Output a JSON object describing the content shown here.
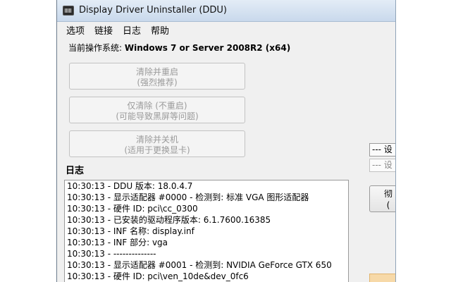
{
  "window": {
    "title": "Display Driver Uninstaller (DDU)",
    "menu": [
      "选项",
      "链接",
      "日志",
      "帮助"
    ],
    "os_label": "当前操作系统:",
    "os_value": "Windows 7 or Server 2008R2 (x64)"
  },
  "actions": [
    {
      "line1": "清除并重启",
      "line2": "(强烈推荐)"
    },
    {
      "line1": "仅清除 (不重启)",
      "line2": "(可能导致黑屏等问题)"
    },
    {
      "line1": "清除并关机",
      "line2": "(适用于更换显卡)"
    }
  ],
  "log": {
    "title": "日志",
    "lines": [
      "10:30:13 - DDU 版本: 18.0.4.7",
      "10:30:13 - 显示适配器 #0000 - 检测到: 标准 VGA 图形适配器",
      "10:30:13 - 硬件 ID: pci\\cc_0300",
      "10:30:13 - 已安装的驱动程序版本: 6.1.7600.16385",
      "10:30:13 - INF 名称: display.inf",
      "10:30:13 - INF 部分: vga",
      "10:30:13 - --------------",
      "10:30:13 - 显示适配器 #0001 - 检测到: NVIDIA GeForce GTX 650",
      "10:30:13 - 硬件 ID: pci\\ven_10de&dev_0fc6"
    ]
  },
  "side": {
    "combo1": "--- 设",
    "combo2": "--- 设",
    "button_line1": "彻",
    "button_line2": "("
  },
  "colors": {
    "title_gradient_top": "#e3ecf6",
    "title_gradient_bottom": "#c9d9ec",
    "window_bg": "#f0f0f0",
    "disabled_text": "#9a9a9a"
  }
}
